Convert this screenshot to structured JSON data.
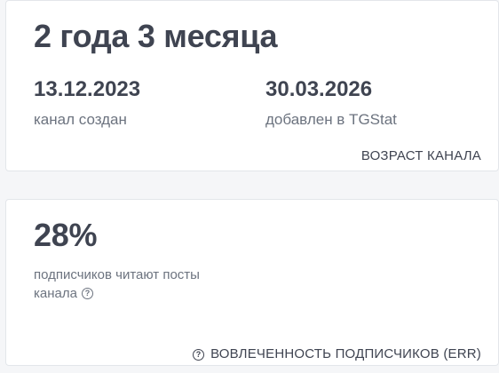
{
  "age_card": {
    "duration": "2 года 3 месяца",
    "created_date": "13.12.2023",
    "created_label": "канал создан",
    "added_date": "30.03.2026",
    "added_label": "добавлен в TGStat",
    "footer_label": "ВОЗРАСТ КАНАЛА"
  },
  "err_card": {
    "percent": "28%",
    "description": "подписчиков читают посты канала",
    "footer_label": "ВОВЛЕЧЕННОСТЬ ПОДПИСЧИКОВ (ERR)",
    "help_icon": "question-circle-icon"
  },
  "colors": {
    "text_primary": "#3f4451",
    "text_secondary": "#6c737f",
    "card_bg": "#ffffff",
    "page_bg": "#f5f6f8"
  }
}
